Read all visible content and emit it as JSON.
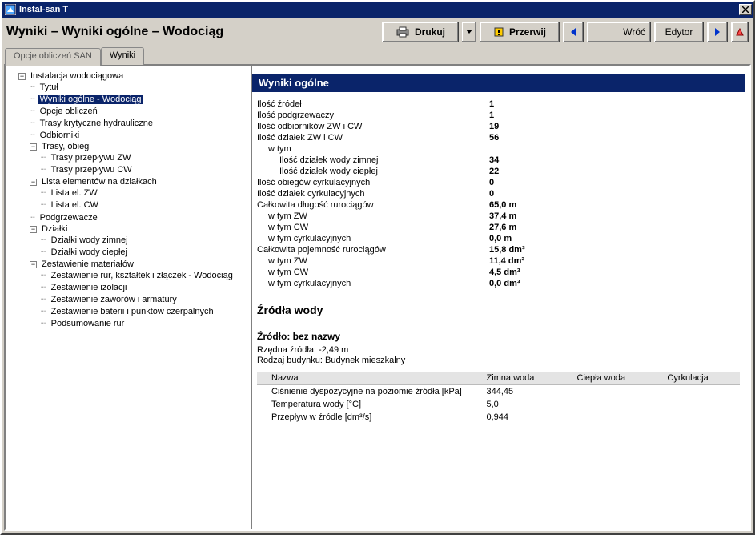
{
  "window": {
    "title": "Instal-san T"
  },
  "breadcrumb": "Wyniki – Wyniki ogólne – Wodociąg",
  "toolbar": {
    "print": "Drukuj",
    "stop": "Przerwij",
    "back_label": "Wróć",
    "editor": "Edytor"
  },
  "tabs": {
    "t1": "Opcje obliczeń SAN",
    "t2": "Wyniki"
  },
  "tree": {
    "root": "Instalacja wodociągowa",
    "n1": "Tytuł",
    "n2": "Wyniki ogólne - Wodociąg",
    "n3": "Opcje obliczeń",
    "n4": "Trasy krytyczne hydrauliczne",
    "n5": "Odbiorniki",
    "n6": "Trasy, obiegi",
    "n6a": "Trasy przepływu ZW",
    "n6b": "Trasy przepływu CW",
    "n7": "Lista elementów na działkach",
    "n7a": "Lista el. ZW",
    "n7b": "Lista el. CW",
    "n8": "Podgrzewacze",
    "n9": "Działki",
    "n9a": "Działki wody zimnej",
    "n9b": "Działki wody ciepłej",
    "n10": "Zestawienie materiałów",
    "n10a": "Zestawienie rur, kształtek i złączek - Wodociąg",
    "n10b": "Zestawienie izolacji",
    "n10c": "Zestawienie zaworów i armatury",
    "n10d": "Zestawienie baterii i punktów czerpalnych",
    "n10e": "Podsumowanie rur"
  },
  "section_title": "Wyniki ogólne",
  "kv": [
    {
      "k": "Ilość źródeł",
      "v": "1",
      "i": 0
    },
    {
      "k": "Ilość podgrzewaczy",
      "v": "1",
      "i": 0
    },
    {
      "k": "Ilość odbiorników ZW i CW",
      "v": "19",
      "i": 0
    },
    {
      "k": "Ilość działek ZW i CW",
      "v": "56",
      "i": 0
    },
    {
      "k": "w tym",
      "v": "",
      "i": 1
    },
    {
      "k": "Ilość działek wody zimnej",
      "v": "34",
      "i": 2
    },
    {
      "k": "Ilość działek wody ciepłej",
      "v": "22",
      "i": 2
    },
    {
      "k": "Ilość obiegów cyrkulacyjnych",
      "v": "0",
      "i": 0
    },
    {
      "k": "Ilość działek cyrkulacyjnych",
      "v": "0",
      "i": 0
    },
    {
      "k": "Całkowita długość rurociągów",
      "v": "65,0 m",
      "i": 0
    },
    {
      "k": "w tym ZW",
      "v": "37,4 m",
      "i": 1
    },
    {
      "k": "w tym CW",
      "v": "27,6 m",
      "i": 1
    },
    {
      "k": "w tym cyrkulacyjnych",
      "v": "0,0 m",
      "i": 1
    },
    {
      "k": "Całkowita pojemność rurociągów",
      "v": "15,8 dm³",
      "i": 0
    },
    {
      "k": "w tym ZW",
      "v": "11,4 dm³",
      "i": 1
    },
    {
      "k": "w tym CW",
      "v": "4,5 dm³",
      "i": 1
    },
    {
      "k": "w tym cyrkulacyjnych",
      "v": "0,0 dm³",
      "i": 1
    }
  ],
  "section2": "Źródła wody",
  "source_title": "Źródło: bez nazwy",
  "source_line1": "Rzędna źródła: -2,49 m",
  "source_line2": "Rodzaj budynku: Budynek mieszkalny",
  "table": {
    "headers": [
      "Nazwa",
      "Zimna woda",
      "Ciepła woda",
      "Cyrkulacja"
    ],
    "rows": [
      [
        "Ciśnienie dyspozycyjne na poziomie źródła [kPa]",
        "344,45",
        "",
        ""
      ],
      [
        "Temperatura wody [°C]",
        "5,0",
        "",
        ""
      ],
      [
        "Przepływ w źródle [dm³/s]",
        "0,944",
        "",
        ""
      ]
    ]
  }
}
